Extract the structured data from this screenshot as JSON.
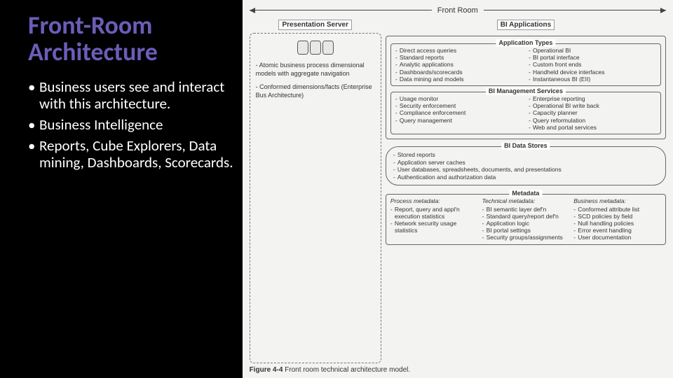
{
  "title": "Front-Room Architecture",
  "bullets": [
    "Business users see and interact with this architecture.",
    "Business Intelligence",
    "Reports, Cube Explorers, Data mining, Dashboards, Scorecards."
  ],
  "diagram": {
    "top_label": "Front Room",
    "presentation_header": "Presentation Server",
    "bi_apps_header": "BI Applications",
    "presentation_box": {
      "line1": "- Atomic business process dimensional models with aggregate navigation",
      "line2": "- Conformed dimensions/facts (Enterprise Bus Architecture)"
    },
    "app_types": {
      "title": "Application Types",
      "left": [
        "Direct access queries",
        "Standard reports",
        "Analytic applications",
        "Dashboards/scorecards",
        "Data mining and models"
      ],
      "right": [
        "Operational BI",
        "BI portal interface",
        "Custom front ends",
        "Handheld device interfaces",
        "Instantaneous BI (EII)"
      ]
    },
    "mgmt": {
      "title": "BI Management Services",
      "left": [
        "Usage monitor",
        "Security enforcement",
        "Compliance enforcement",
        "Query management"
      ],
      "right": [
        "Enterprise reporting",
        "Operational BI write back",
        "Capacity planner",
        "Query reformulation",
        "Web and portal services"
      ]
    },
    "stores": {
      "title": "BI Data Stores",
      "items": [
        "Stored reports",
        "Application server caches",
        "User databases, spreadsheets, documents, and presentations",
        "Authentication and authorization data"
      ]
    },
    "metadata": {
      "title": "Metadata",
      "cols": [
        {
          "head": "Process metadata:",
          "items": [
            "Report, query and appl'n execution statistics",
            "Network security usage statistics"
          ]
        },
        {
          "head": "Technical metadata:",
          "items": [
            "BI semantic layer def'n",
            "Standard query/report def'n",
            "Application logic",
            "BI portal settings",
            "Security groups/assignments"
          ]
        },
        {
          "head": "Business metadata:",
          "items": [
            "Conformed attribute list",
            "SCD policies by field",
            "Null handling policies",
            "Error event handling",
            "User documentation"
          ]
        }
      ]
    },
    "caption_bold": "Figure 4-4",
    "caption_text": " Front room technical architecture model."
  }
}
